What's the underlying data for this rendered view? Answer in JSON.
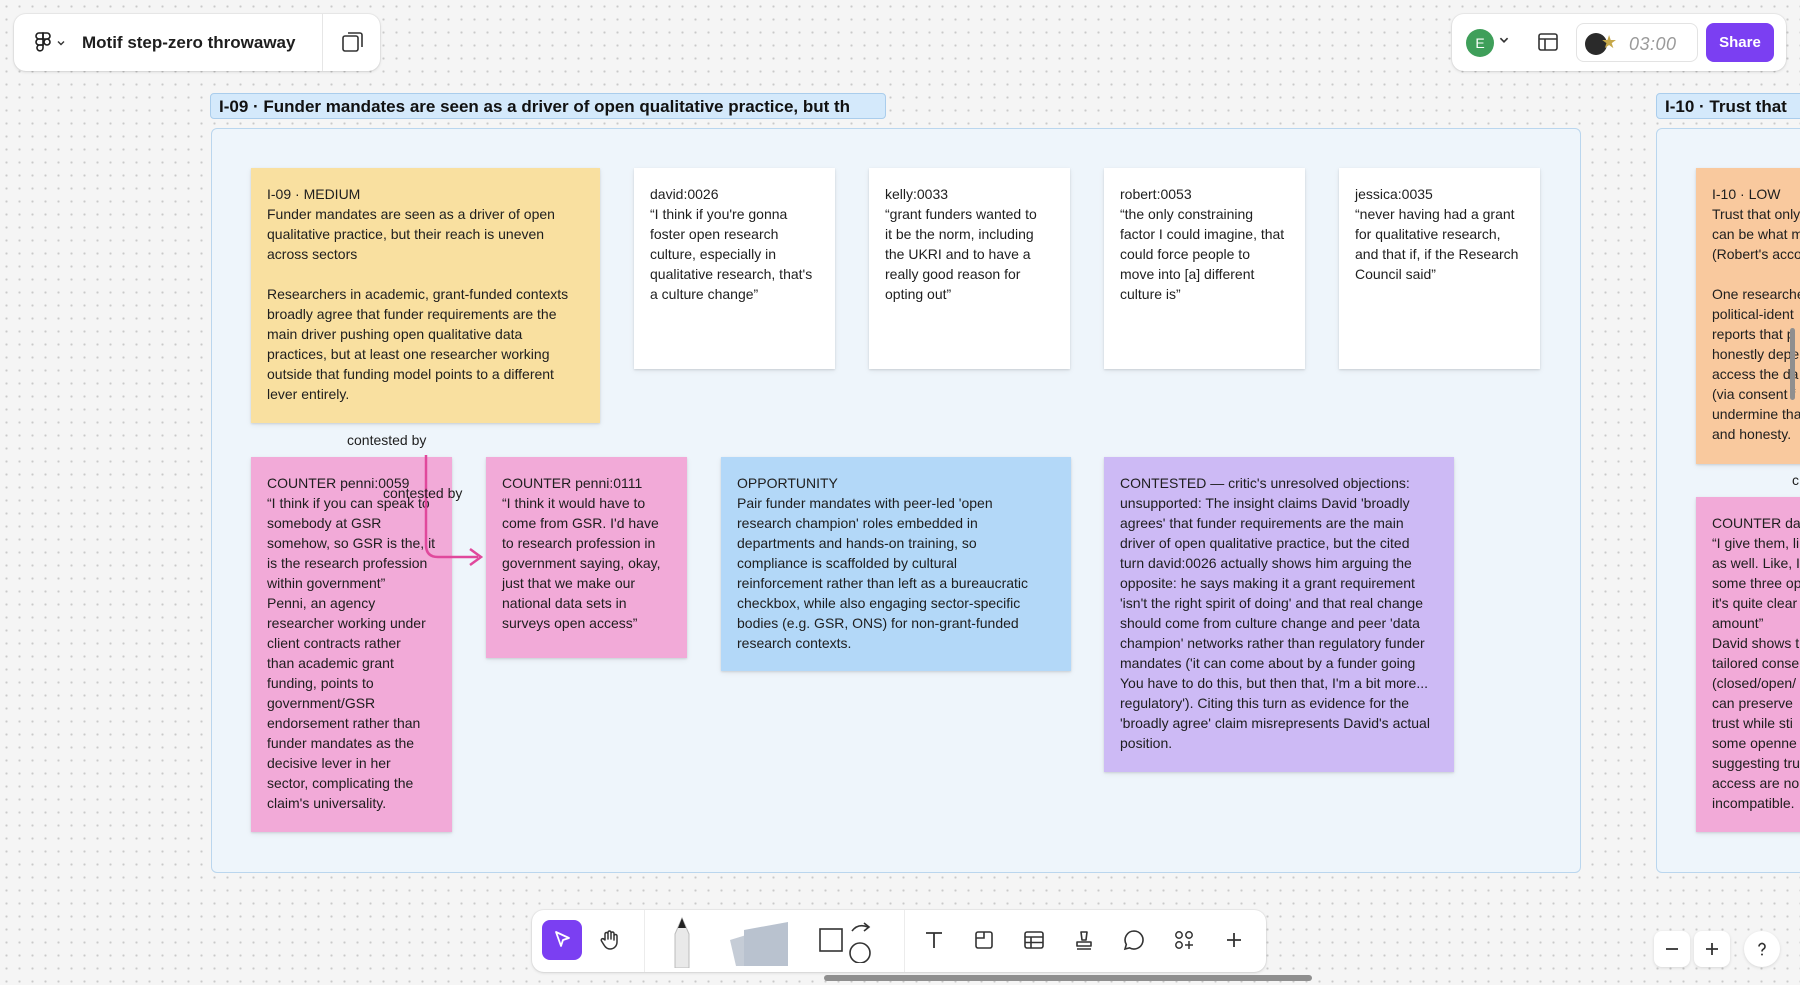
{
  "file": {
    "title": "Motif step-zero throwaway"
  },
  "header": {
    "avatar_initial": "E",
    "timer": "03:00",
    "share_label": "Share"
  },
  "colors": {
    "accent": "#7b3ff2",
    "section_label_bg": "#d4e9fb",
    "sticky_yellow": "#f9e0a0",
    "sticky_pink": "#f2aad8",
    "sticky_blue": "#b3d8f8",
    "sticky_purple": "#cdbaf5",
    "sticky_orange": "#f9c99e",
    "connector": "#e0489c"
  },
  "icons": {
    "logo": "figma-logo-icon",
    "pages": "pages-icon",
    "layout": "layout-panel-icon",
    "tools": [
      "cursor-icon",
      "hand-icon",
      "pen-icon",
      "sticky-stack-icon",
      "shapes-icon",
      "text-icon",
      "section-icon",
      "table-icon",
      "stamp-icon",
      "comment-icon",
      "widgets-icon",
      "plus-icon"
    ]
  },
  "sections": [
    {
      "label": "I-09 · Funder mandates are seen as a driver of open qualitative practice, but th"
    },
    {
      "label": "I-10 · Trust that"
    }
  ],
  "stickies": {
    "claim": {
      "header": "I-09 · MEDIUM",
      "body": "Funder mandates are seen as a driver of open\nqualitative practice, but their reach is uneven\nacross sectors\n\nResearchers in academic, grant-funded contexts\nbroadly agree that funder requirements are the\nmain driver pushing open qualitative data\npractices, but at least one researcher working\noutside that funding model points to a different\nlever entirely."
    },
    "quotes": [
      {
        "header": "david:0026",
        "body": "“I think if you're gonna\nfoster open research\nculture, especially in\nqualitative research, that's\na culture change”"
      },
      {
        "header": "kelly:0033",
        "body": "“grant funders wanted to\nit be the norm, including\nthe UKRI and to have a\nreally good reason for\nopting out”"
      },
      {
        "header": "robert:0053",
        "body": "“the only constraining\nfactor I could imagine, that\ncould force people to\nmove into [a] different\nculture is”"
      },
      {
        "header": "jessica:0035",
        "body": "“never having had a grant\nfor qualitative research,\nand that if, if the Research\nCouncil said”"
      }
    ],
    "counter1": {
      "header": "COUNTER penni:0059",
      "body": "“I think if you can speak to\nsomebody at GSR\nsomehow, so GSR is the, it\nis the research profession\nwithin government”\nPenni, an agency\nresearcher working under\nclient contracts rather\nthan academic grant\nfunding, points to\ngovernment/GSR\nendorsement rather than\nfunder mandates as the\ndecisive lever in her\nsector, complicating the\nclaim's universality."
    },
    "counter2": {
      "header": "COUNTER penni:0111",
      "body": "“I think it would have to\ncome from GSR. I'd have\nto research profession in\ngovernment saying, okay,\njust that we make our\nnational data sets in\nsurveys open access”"
    },
    "opportunity": {
      "header": "OPPORTUNITY",
      "body": "Pair funder mandates with peer-led 'open\nresearch champion' roles embedded in\ndepartments and hands-on training, so\ncompliance is scaffolded by cultural\nreinforcement rather than left as a bureaucratic\ncheckbox, while also engaging sector-specific\nbodies (e.g. GSR, ONS) for non-grant-funded\nresearch contexts."
    },
    "contested": {
      "header": "CONTESTED — critic's unresolved objections:",
      "body": "unsupported: The insight claims David 'broadly\nagrees' that funder requirements are the main\ndriver of open qualitative practice, but the cited\nturn david:0026 actually shows him arguing the\nopposite: he says making it a grant requirement\n'isn't the right spirit of doing' and that real change\nshould come from culture change and peer 'data\nchampion' networks rather than regulatory funder\nmandates ('it can come about by a funder going\nYou have to do this, but then that, I'm a bit more...\nregulatory'). Citing this turn as evidence for the\n'broadly agree' claim misrepresents David's actual\nposition."
    },
    "next_claim": {
      "header": "I-10 · LOW",
      "body": "Trust that only\ncan be what m\n(Robert's acco\n\nOne researche\npolitical-ident\nreports that p\nhonestly depe\naccess the da\n(via consent f\nundermine tha\nand honesty."
    },
    "next_counter": {
      "header": "COUNTER dav",
      "body": "“I give them, li\nas well. Like, I\nsome three op\nit's quite clear\namount”\nDavid shows t\ntailored conse\n(closed/open/\ncan preserve\ntrust while sti\nsome openne\nsuggesting tru\naccess are no\nincompatible."
    }
  },
  "connectors": {
    "label1": "contested by",
    "label2": "contested by",
    "label3": "c"
  }
}
